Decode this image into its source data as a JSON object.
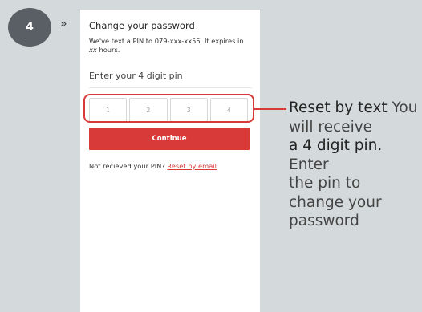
{
  "step": {
    "number": "4",
    "chevron": "»"
  },
  "screen": {
    "title": "Change your password",
    "desc_1": "We've text a PIN to 079-xxx-xx55. It expires in",
    "desc_2a": "xx",
    "desc_2b": " hours.",
    "pin_label": "Enter your 4 digit pin",
    "pin_boxes": [
      "1",
      "2",
      "3",
      "4"
    ],
    "continue_label": "Continue",
    "resend_prefix": "Not recieved your PIN?",
    "resend_link": "Reset by email"
  },
  "callout": {
    "title": "Reset by text",
    "line1_rest": " You",
    "line2": "will receive",
    "line3": "a 4 digit pin.",
    "line4": "Enter",
    "line5": "the pin to",
    "line6": "change your",
    "line7": "password"
  },
  "colors": {
    "accent": "#d83a3a",
    "badge": "#5a5f66",
    "background": "#d4dadb"
  }
}
